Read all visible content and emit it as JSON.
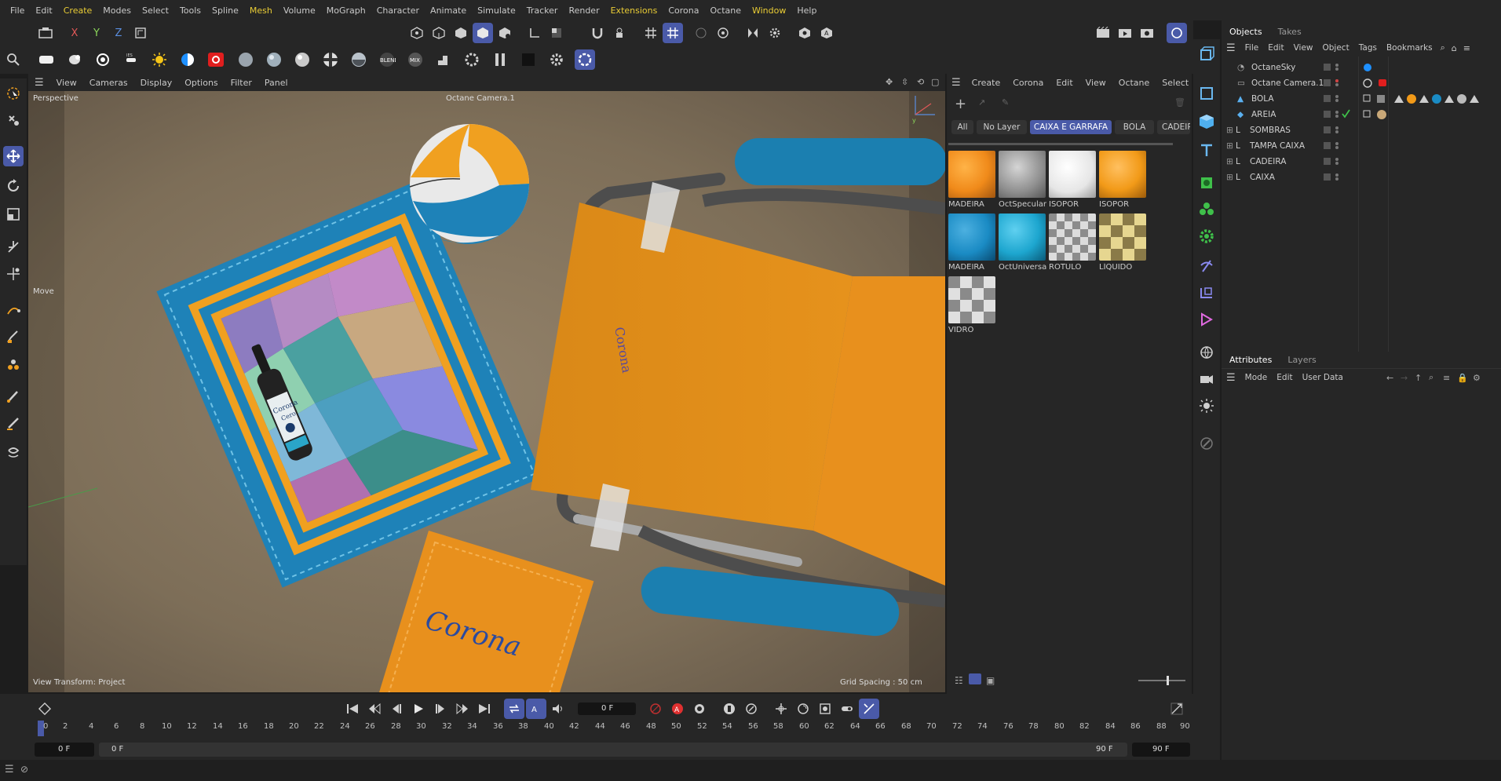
{
  "menubar": {
    "items": [
      "File",
      "Edit",
      "Create",
      "Modes",
      "Select",
      "Tools",
      "Spline",
      "Mesh",
      "Volume",
      "MoGraph",
      "Character",
      "Animate",
      "Simulate",
      "Tracker",
      "Render",
      "Extensions",
      "Corona",
      "Octane",
      "Window",
      "Help"
    ]
  },
  "toolbar_axes": {
    "x": "X",
    "y": "Y",
    "z": "Z"
  },
  "viewport": {
    "menu": [
      "View",
      "Cameras",
      "Display",
      "Options",
      "Filter",
      "Panel"
    ],
    "view_name": "Perspective",
    "camera_label": "Octane Camera.1",
    "tool_label": "Move",
    "bottom_left": "View Transform: Project",
    "bottom_right": "Grid Spacing : 50 cm",
    "bottle_brand": "Corona",
    "bottle_sub": "Cero",
    "mat_brand": "Corona"
  },
  "materials": {
    "menu": [
      "Create",
      "Corona",
      "Edit",
      "View",
      "Octane",
      "Select"
    ],
    "filters": [
      "All",
      "No Layer",
      "CAIXA E GARRAFA",
      "BOLA",
      "CADEIR"
    ],
    "items": [
      {
        "name": "MADEIRA",
        "color": "#f08a1a"
      },
      {
        "name": "OctSpecular",
        "color": "#9a9a9a"
      },
      {
        "name": "ISOPOR",
        "color": "#f2f2f2"
      },
      {
        "name": "ISOPOR",
        "color": "#f29a18"
      },
      {
        "name": "MADEIRA",
        "color": "#1a8bc4"
      },
      {
        "name": "OctUniversal",
        "color": "#1da6cf"
      },
      {
        "name": "RÓTULO",
        "color": "#bcbcbc"
      },
      {
        "name": "LÍQUIDO",
        "color": "#d8c680"
      },
      {
        "name": "VIDRO",
        "color": "#c8c8c8"
      }
    ]
  },
  "objects": {
    "tabs": [
      "Objects",
      "Takes"
    ],
    "menu": [
      "File",
      "Edit",
      "View",
      "Object",
      "Tags",
      "Bookmarks"
    ],
    "rows": [
      "OctaneSky",
      "Octane Camera.1",
      "BOLA",
      "AREIA",
      "SOMBRAS",
      "TAMPA CAIXA",
      "CADEIRA",
      "CAIXA"
    ]
  },
  "attributes": {
    "tabs": [
      "Attributes",
      "Layers"
    ],
    "menu": [
      "Mode",
      "Edit",
      "User Data"
    ]
  },
  "timeline": {
    "current_frame": "0 F",
    "ticks": [
      "0",
      "2",
      "4",
      "6",
      "8",
      "10",
      "12",
      "14",
      "16",
      "18",
      "20",
      "22",
      "24",
      "26",
      "28",
      "30",
      "32",
      "34",
      "36",
      "38",
      "40",
      "42",
      "44",
      "46",
      "48",
      "50",
      "52",
      "54",
      "56",
      "58",
      "60",
      "62",
      "64",
      "66",
      "68",
      "70",
      "72",
      "74",
      "76",
      "78",
      "80",
      "82",
      "84",
      "86",
      "88",
      "90"
    ],
    "start_a": "0 F",
    "start_b": "0 F",
    "end_a": "90 F",
    "end_b": "90 F"
  },
  "colors": {
    "accent": "#4a5aa8",
    "highlight_menu": "#e9cc35",
    "chair_orange": "#e8901d",
    "chair_blue": "#1b7fb0",
    "sand": "#8a7a62"
  }
}
